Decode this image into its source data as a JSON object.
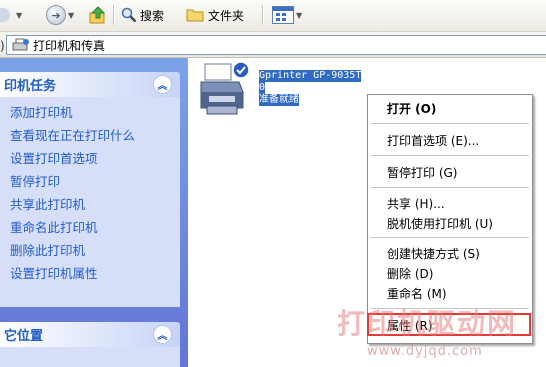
{
  "toolbar": {
    "search_label": "搜索",
    "folders_label": "文件夹"
  },
  "address": {
    "path": "打印机和传真"
  },
  "tasks_panel": {
    "title": "印机任务",
    "items": [
      "添加打印机",
      "查看现在正在打印什么",
      "设置打印首选项",
      "暂停打印",
      "共享此打印机",
      "重命名此打印机",
      "删除此打印机",
      "设置打印机属性"
    ]
  },
  "places_panel": {
    "title": "它位置"
  },
  "printer": {
    "name": "Gprinter  GP-9035T",
    "docs": "0",
    "status": "准备就绪"
  },
  "context_menu": {
    "items": [
      {
        "label": "打开 (O)",
        "bold": true
      },
      {
        "label": "打印首选项 (E)..."
      },
      {
        "label": "暂停打印 (G)"
      },
      {
        "label": "共享 (H)..."
      },
      {
        "label": "脱机使用打印机 (U)"
      },
      {
        "label": "创建快捷方式 (S)"
      },
      {
        "label": "删除 (D)"
      },
      {
        "label": "重命名 (M)"
      },
      {
        "label": "属性 (R)"
      }
    ]
  },
  "watermark": {
    "title": "打印机驱动网",
    "url": "www.dyjqd.com"
  },
  "colors": {
    "task_link": "#215dc6",
    "selection": "#316ac5",
    "highlight_border": "#e53935"
  }
}
